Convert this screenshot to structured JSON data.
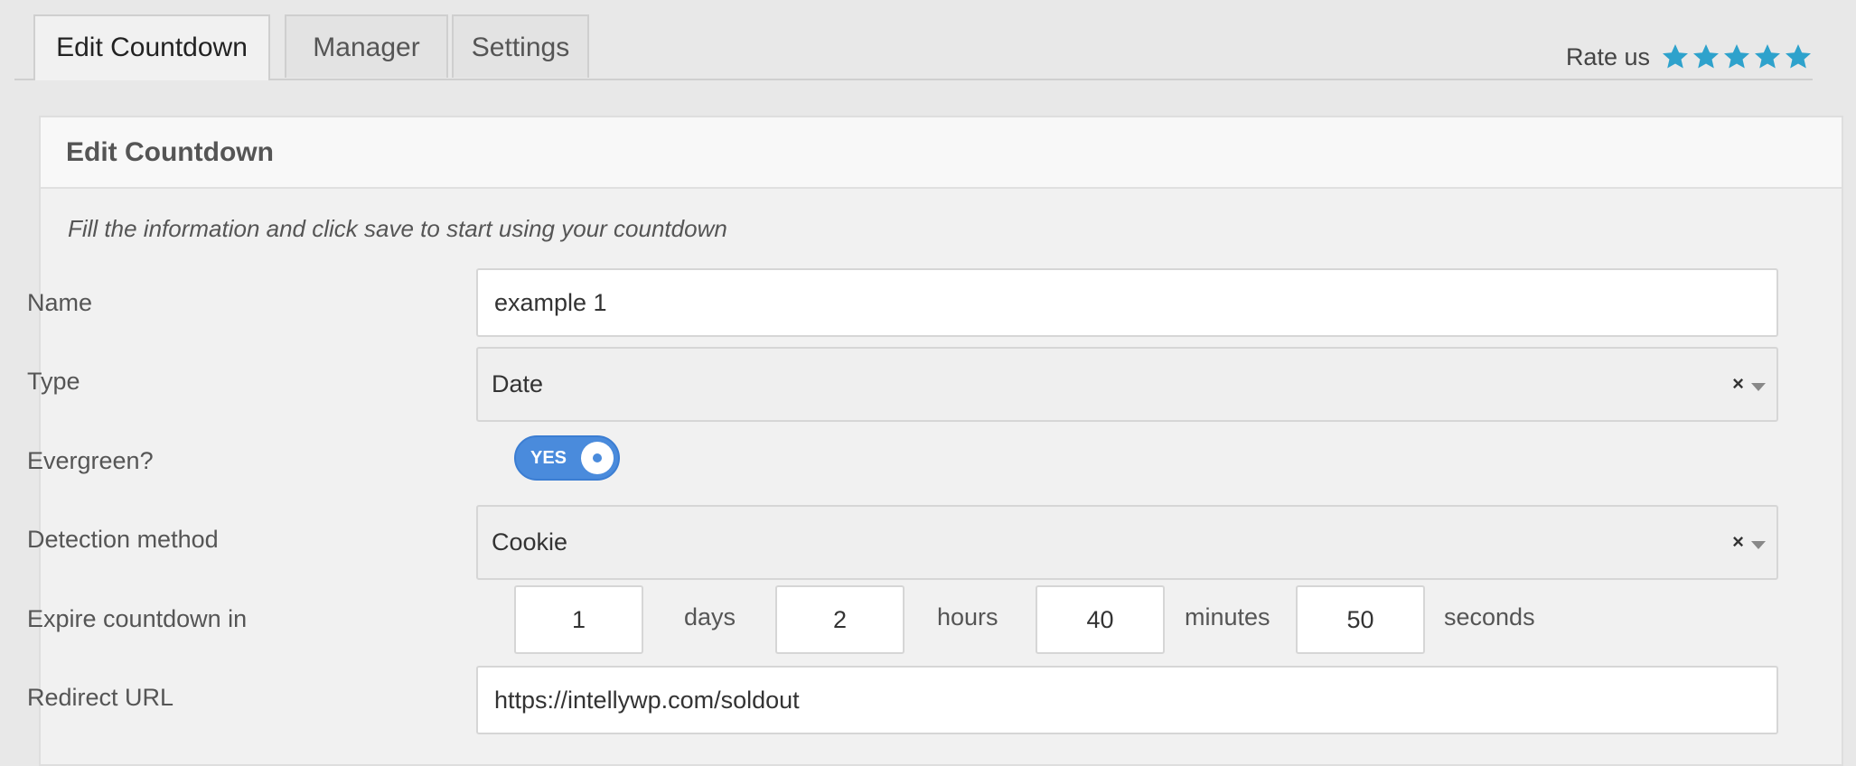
{
  "tabs": [
    {
      "label": "Edit Countdown",
      "active": true
    },
    {
      "label": "Manager",
      "active": false
    },
    {
      "label": "Settings",
      "active": false
    }
  ],
  "rate": {
    "label": "Rate us",
    "stars": 5,
    "star_color": "#2ea2cc"
  },
  "panel": {
    "title": "Edit Countdown",
    "intro": "Fill the information and click save to start using your countdown"
  },
  "form": {
    "name": {
      "label": "Name",
      "value": "example 1"
    },
    "type": {
      "label": "Type",
      "value": "Date",
      "clear": "×"
    },
    "evergreen": {
      "label": "Evergreen?",
      "toggle_text": "YES",
      "on": true
    },
    "detection": {
      "label": "Detection method",
      "value": "Cookie",
      "clear": "×"
    },
    "expire": {
      "label": "Expire countdown in",
      "days": "1",
      "days_unit": "days",
      "hours": "2",
      "hours_unit": "hours",
      "minutes": "40",
      "minutes_unit": "minutes",
      "seconds": "50",
      "seconds_unit": "seconds"
    },
    "redirect": {
      "label": "Redirect URL",
      "value": "https://intellywp.com/soldout"
    }
  },
  "colors": {
    "accent": "#4a8bdc",
    "star": "#2ea2cc"
  }
}
